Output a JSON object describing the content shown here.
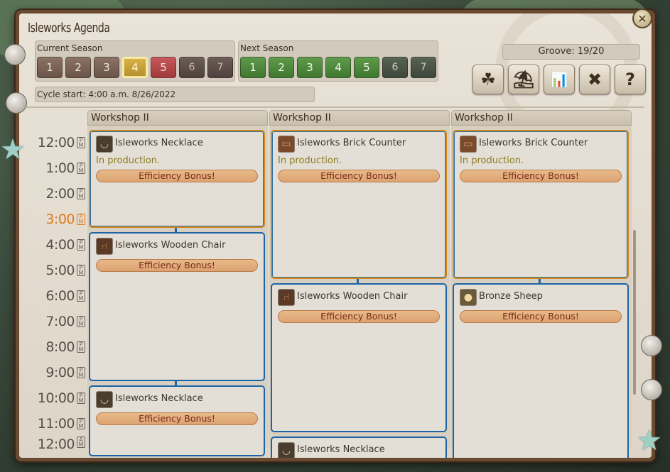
{
  "window": {
    "title": "Isleworks Agenda"
  },
  "current_season": {
    "label": "Current Season",
    "days": [
      "1",
      "2",
      "3",
      "4",
      "5",
      "6",
      "7"
    ],
    "selected_day": "4"
  },
  "next_season": {
    "label": "Next Season",
    "days": [
      "1",
      "2",
      "3",
      "4",
      "5",
      "6",
      "7"
    ]
  },
  "groove": "Groove: 19/20",
  "cycle_start": "Cycle start: 4:00 a.m. 8/26/2022",
  "toolbar": {
    "icons": [
      "season-palette-icon",
      "rest-day-icon",
      "supply-demand-icon",
      "cancel-icon",
      "help-icon"
    ],
    "glyphs": [
      "☘",
      "⛱",
      "📊",
      "✖",
      "?"
    ]
  },
  "timeline": {
    "current_hour": "3:00",
    "hours": [
      "12:00",
      "1:00",
      "2:00",
      "3:00",
      "4:00",
      "5:00",
      "6:00",
      "7:00",
      "8:00",
      "9:00",
      "10:00",
      "11:00",
      "12:00"
    ],
    "ampm_top": "P",
    "ampm_bottom": "M",
    "am_last_top": "A"
  },
  "workshops": [
    {
      "name": "Workshop II",
      "items": [
        {
          "name": "Isleworks Necklace",
          "status": "In production.",
          "bonus": "Efficiency Bonus!",
          "icon": "necklace-icon"
        },
        {
          "name": "Isleworks Wooden Chair",
          "status": "",
          "bonus": "Efficiency Bonus!",
          "icon": "wooden-chair-icon"
        },
        {
          "name": "Isleworks Necklace",
          "status": "",
          "bonus": "Efficiency Bonus!",
          "icon": "necklace-icon"
        }
      ]
    },
    {
      "name": "Workshop II",
      "items": [
        {
          "name": "Isleworks Brick Counter",
          "status": "In production.",
          "bonus": "Efficiency Bonus!",
          "icon": "brick-counter-icon"
        },
        {
          "name": "Isleworks Wooden Chair",
          "status": "",
          "bonus": "Efficiency Bonus!",
          "icon": "wooden-chair-icon"
        },
        {
          "name": "Isleworks Necklace",
          "status": "",
          "bonus": "",
          "icon": "necklace-icon"
        }
      ]
    },
    {
      "name": "Workshop II",
      "items": [
        {
          "name": "Isleworks Brick Counter",
          "status": "In production.",
          "bonus": "Efficiency Bonus!",
          "icon": "brick-counter-icon"
        },
        {
          "name": "Bronze Sheep",
          "status": "",
          "bonus": "Efficiency Bonus!",
          "icon": "bronze-sheep-icon"
        }
      ]
    }
  ],
  "colors": {
    "selected_day": "#d9b44a",
    "slot_border": "#1d64a6",
    "active_slot_border": "#d28a1e",
    "current_time": "#e07a1a",
    "bonus_fill": "#e3af7e"
  }
}
